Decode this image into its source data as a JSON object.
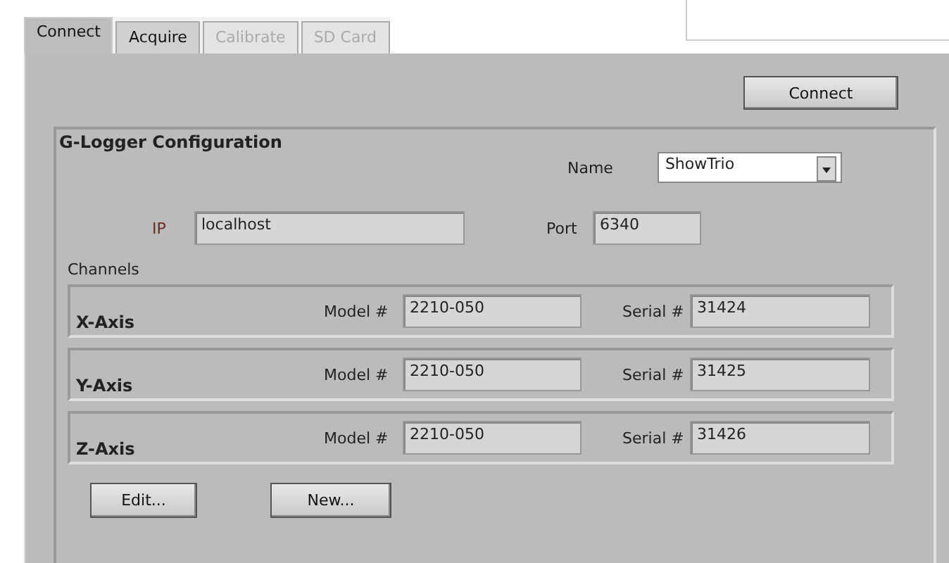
{
  "tabs": [
    {
      "label": "Connect",
      "selected": true,
      "disabled": false
    },
    {
      "label": "Acquire",
      "selected": false,
      "disabled": false
    },
    {
      "label": "Calibrate",
      "selected": false,
      "disabled": true
    },
    {
      "label": "SD Card",
      "selected": false,
      "disabled": true
    }
  ],
  "connect_button": "Connect",
  "configuration": {
    "title": "G-Logger Configuration",
    "name": {
      "label": "Name",
      "value": "ShowTrio"
    },
    "ip": {
      "label": "IP",
      "value": "localhost"
    },
    "port": {
      "label": "Port",
      "value": "6340"
    },
    "channels_label": "Channels",
    "channels": [
      {
        "axis": "X-Axis",
        "model_label": "Model #",
        "model": "2210-050",
        "serial_label": "Serial #",
        "serial": "31424"
      },
      {
        "axis": "Y-Axis",
        "model_label": "Model #",
        "model": "2210-050",
        "serial_label": "Serial #",
        "serial": "31425"
      },
      {
        "axis": "Z-Axis",
        "model_label": "Model #",
        "model": "2210-050",
        "serial_label": "Serial #",
        "serial": "31426"
      }
    ],
    "buttons": [
      "Edit...",
      "New..."
    ]
  }
}
